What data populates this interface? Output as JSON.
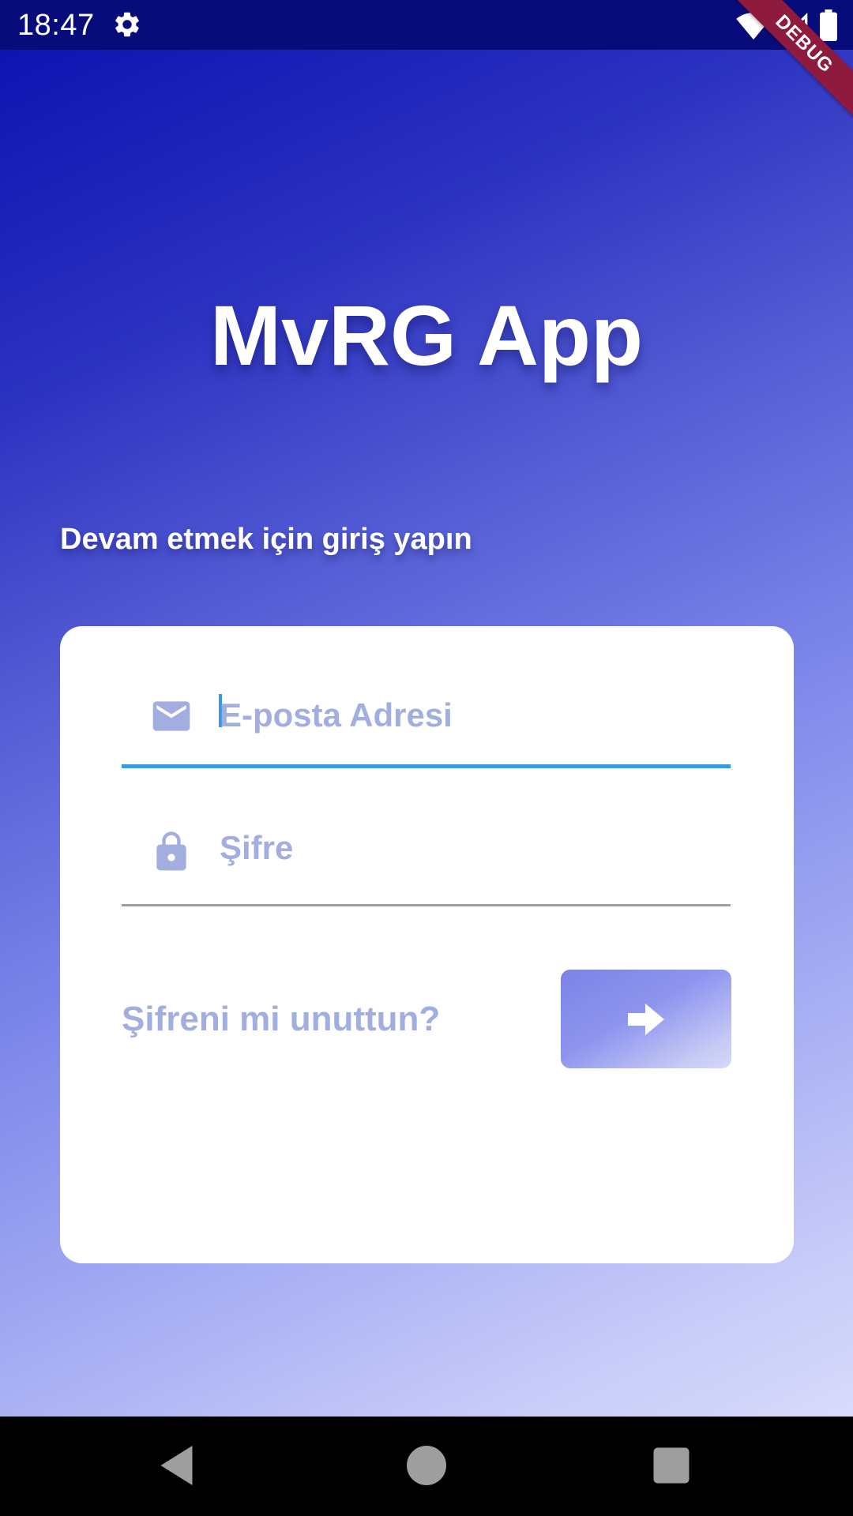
{
  "status_bar": {
    "time": "18:47",
    "left_icons": [
      "gear-icon"
    ],
    "right_icons": [
      "wifi-icon",
      "cell-signal-icon",
      "battery-icon"
    ]
  },
  "debug_banner": {
    "label": "DEBUG"
  },
  "app": {
    "title": "MvRG App",
    "subtitle": "Devam etmek için giriş yapın"
  },
  "login_form": {
    "email": {
      "placeholder": "E-posta Adresi",
      "value": "",
      "icon": "email-icon",
      "focused": true
    },
    "password": {
      "placeholder": "Şifre",
      "value": "",
      "icon": "lock-icon"
    },
    "forgot_link": "Şifreni mi unuttun?",
    "submit_icon": "arrow-right-icon"
  },
  "nav_bar": {
    "buttons": [
      "back-icon",
      "home-icon",
      "recents-icon"
    ]
  },
  "colors": {
    "status_bar": "#070c7a",
    "gradient_start": "#0a0fb0",
    "gradient_end": "#d8dbfb",
    "field_focus": "#3a98e0",
    "placeholder": "#a3aee0",
    "debug_banner": "#8e1a3e"
  }
}
